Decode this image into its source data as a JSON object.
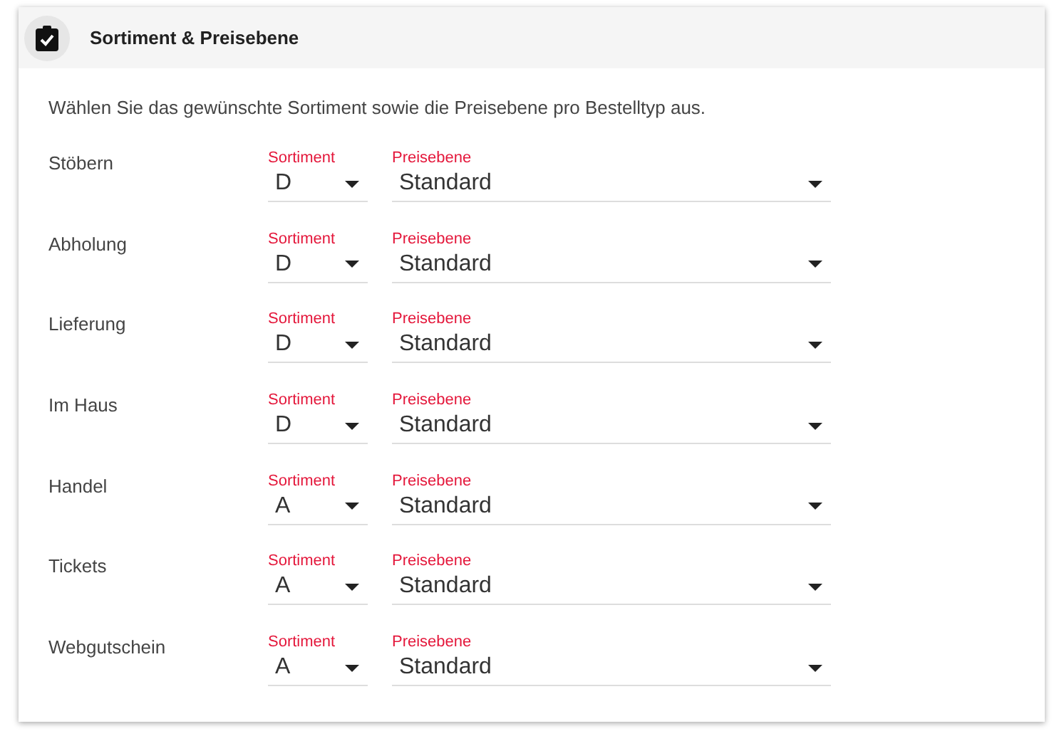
{
  "header": {
    "title": "Sortiment & Preisebene"
  },
  "description": "Wählen Sie das gewünschte Sortiment sowie die Preisebene pro Bestelltyp aus.",
  "rows": [
    {
      "label": "Stöbern",
      "sortiment": {
        "label": "Sortiment",
        "value": "D"
      },
      "preisebene": {
        "label": "Preisebene",
        "value": "Standard"
      }
    },
    {
      "label": "Abholung",
      "sortiment": {
        "label": "Sortiment",
        "value": "D"
      },
      "preisebene": {
        "label": "Preisebene",
        "value": "Standard"
      }
    },
    {
      "label": "Lieferung",
      "sortiment": {
        "label": "Sortiment",
        "value": "D"
      },
      "preisebene": {
        "label": "Preisebene",
        "value": "Standard"
      }
    },
    {
      "label": "Im Haus",
      "sortiment": {
        "label": "Sortiment",
        "value": "D"
      },
      "preisebene": {
        "label": "Preisebene",
        "value": "Standard"
      }
    },
    {
      "label": "Handel",
      "sortiment": {
        "label": "Sortiment",
        "value": "A"
      },
      "preisebene": {
        "label": "Preisebene",
        "value": "Standard"
      }
    },
    {
      "label": "Tickets",
      "sortiment": {
        "label": "Sortiment",
        "value": "A"
      },
      "preisebene": {
        "label": "Preisebene",
        "value": "Standard"
      }
    },
    {
      "label": "Webgutschein",
      "sortiment": {
        "label": "Sortiment",
        "value": "A"
      },
      "preisebene": {
        "label": "Preisebene",
        "value": "Standard"
      }
    }
  ]
}
